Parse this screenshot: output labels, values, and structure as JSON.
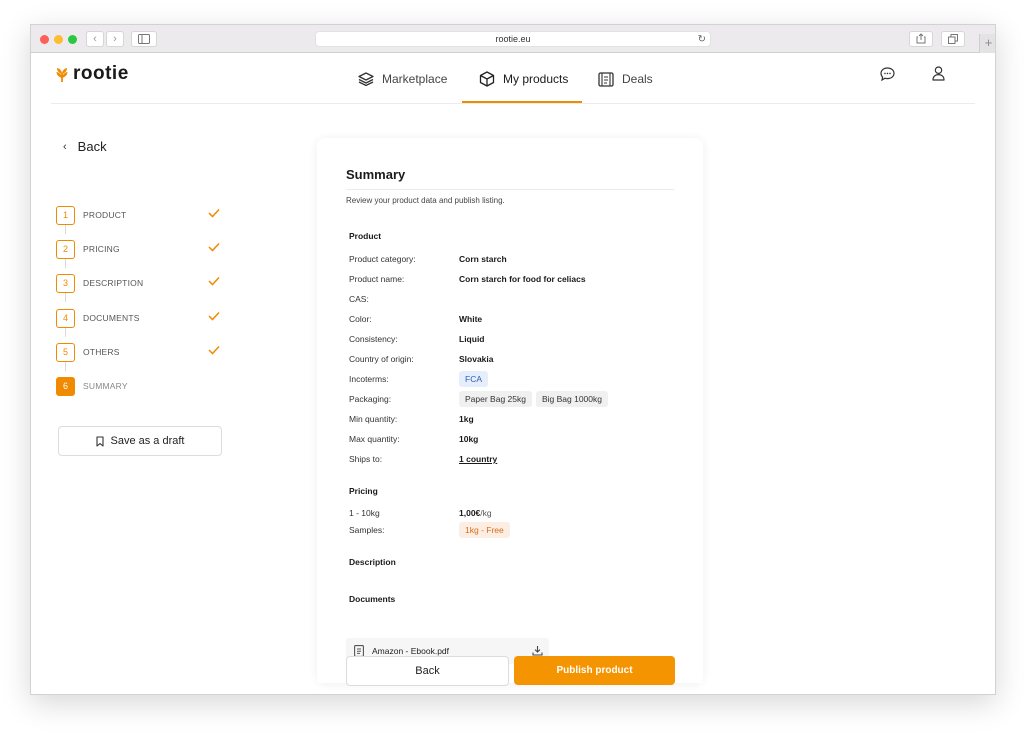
{
  "browser": {
    "url": "rootie.eu"
  },
  "brand": {
    "name": "rootie",
    "accent": "#F39400"
  },
  "nav": {
    "items": [
      {
        "label": "Marketplace",
        "icon": "layers-icon"
      },
      {
        "label": "My products",
        "icon": "box-icon",
        "active": true
      },
      {
        "label": "Deals",
        "icon": "deals-icon"
      }
    ]
  },
  "sidebar": {
    "back_label": "Back",
    "steps": [
      {
        "num": "1",
        "label": "PRODUCT",
        "done": true
      },
      {
        "num": "2",
        "label": "PRICING",
        "done": true
      },
      {
        "num": "3",
        "label": "DESCRIPTION",
        "done": true
      },
      {
        "num": "4",
        "label": "DOCUMENTS",
        "done": true
      },
      {
        "num": "5",
        "label": "OTHERS",
        "done": true
      },
      {
        "num": "6",
        "label": "SUMMARY",
        "active": true
      }
    ],
    "draft_label": "Save as a draft"
  },
  "summary": {
    "title": "Summary",
    "subtitle": "Review your product data and publish listing.",
    "product": {
      "heading": "Product",
      "rows": [
        {
          "label": "Product category:",
          "value": "Corn starch"
        },
        {
          "label": "Product name:",
          "value": "Corn starch for food for celiacs"
        },
        {
          "label": "CAS:",
          "value": ""
        },
        {
          "label": "Color:",
          "value": "White"
        },
        {
          "label": "Consistency:",
          "value": "Liquid"
        },
        {
          "label": "Country of origin:",
          "value": "Slovakia"
        }
      ],
      "incoterms_label": "Incoterms:",
      "incoterms_value": "FCA",
      "packaging_label": "Packaging:",
      "packaging_values": [
        "Paper Bag 25kg",
        "Big Bag 1000kg"
      ],
      "min_label": "Min quantity:",
      "min_value": "1kg",
      "max_label": "Max quantity:",
      "max_value": "10kg",
      "ships_label": "Ships to:",
      "ships_value": "1 country"
    },
    "pricing": {
      "heading": "Pricing",
      "range": "1 - 10kg",
      "price": "1,00€",
      "price_unit": "/kg",
      "samples_label": "Samples:",
      "samples_value": "1kg - Free"
    },
    "description": {
      "heading": "Description"
    },
    "documents": {
      "heading": "Documents",
      "files": [
        {
          "name": "Amazon - Ebook.pdf"
        }
      ]
    }
  },
  "footer": {
    "back_label": "Back",
    "publish_label": "Publish product"
  }
}
